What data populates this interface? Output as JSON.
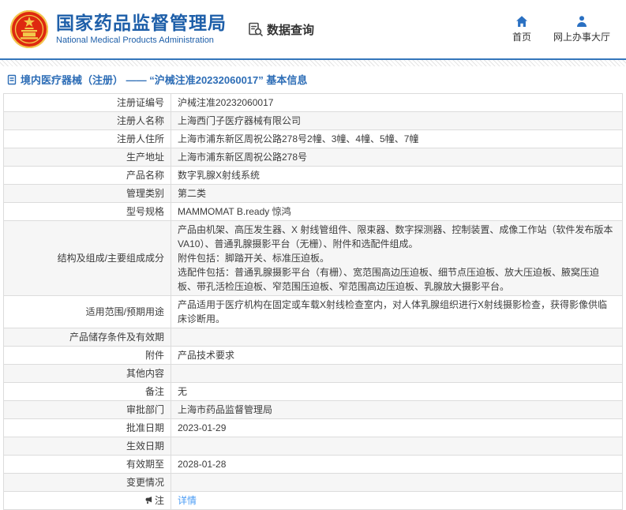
{
  "header": {
    "logo": {
      "icon": "china-national-emblem"
    },
    "agency_name_cn": "国家药品监督管理局",
    "agency_name_en": "National Medical Products Administration",
    "data_query": {
      "label": "数据查询",
      "icon": "document-search-icon"
    },
    "nav": [
      {
        "label": "首页",
        "icon": "home-icon"
      },
      {
        "label": "网上办事大厅",
        "icon": "user-icon"
      }
    ]
  },
  "breadcrumb": {
    "icon": "document-icon",
    "text": "境内医疗器械（注册） —— “沪械注准20232060017” 基本信息"
  },
  "table": {
    "rows": [
      {
        "label": "注册证编号",
        "value": "沪械注准20232060017"
      },
      {
        "label": "注册人名称",
        "value": "上海西门子医疗器械有限公司"
      },
      {
        "label": "注册人住所",
        "value": "上海市浦东新区周祝公路278号2幢、3幢、4幢、5幢、7幢"
      },
      {
        "label": "生产地址",
        "value": "上海市浦东新区周祝公路278号"
      },
      {
        "label": "产品名称",
        "value": "数字乳腺X射线系统"
      },
      {
        "label": "管理类别",
        "value": "第二类"
      },
      {
        "label": "型号规格",
        "value": "MAMMOMAT B.ready 惊鸿"
      },
      {
        "label": "结构及组成/主要组成成分",
        "value": "产品由机架、高压发生器、X 射线管组件、限束器、数字探测器、控制装置、成像工作站（软件发布版本VA10）、普通乳腺摄影平台（无栅）、附件和选配件组成。\n附件包括：脚踏开关、标准压迫板。\n选配件包括：普通乳腺摄影平台（有栅）、宽范围高边压迫板、细节点压迫板、放大压迫板、腋窝压迫板、带孔活检压迫板、窄范围压迫板、窄范围高边压迫板、乳腺放大摄影平台。"
      },
      {
        "label": "适用范围/预期用途",
        "value": "产品适用于医疗机构在固定或车载X射线检查室内，对人体乳腺组织进行X射线摄影检查，获得影像供临床诊断用。"
      },
      {
        "label": "产品储存条件及有效期",
        "value": ""
      },
      {
        "label": "附件",
        "value": "产品技术要求"
      },
      {
        "label": "其他内容",
        "value": ""
      },
      {
        "label": "备注",
        "value": "无"
      },
      {
        "label": "审批部门",
        "value": "上海市药品监督管理局"
      },
      {
        "label": "批准日期",
        "value": "2023-01-29"
      },
      {
        "label": "生效日期",
        "value": ""
      },
      {
        "label": "有效期至",
        "value": "2028-01-28"
      },
      {
        "label": "变更情况",
        "value": ""
      },
      {
        "label": "注",
        "label_icon": "megaphone-icon",
        "value": "详情",
        "link": true
      }
    ]
  },
  "colors": {
    "brand_blue": "#1e5fa9",
    "icon_blue": "#2a70c2",
    "breadcrumb_blue": "#2d6db6",
    "divider_blue": "#3476bb",
    "link_blue": "#4a9cf5",
    "emblem_red": "#de2910",
    "emblem_gold": "#f2c94c"
  }
}
